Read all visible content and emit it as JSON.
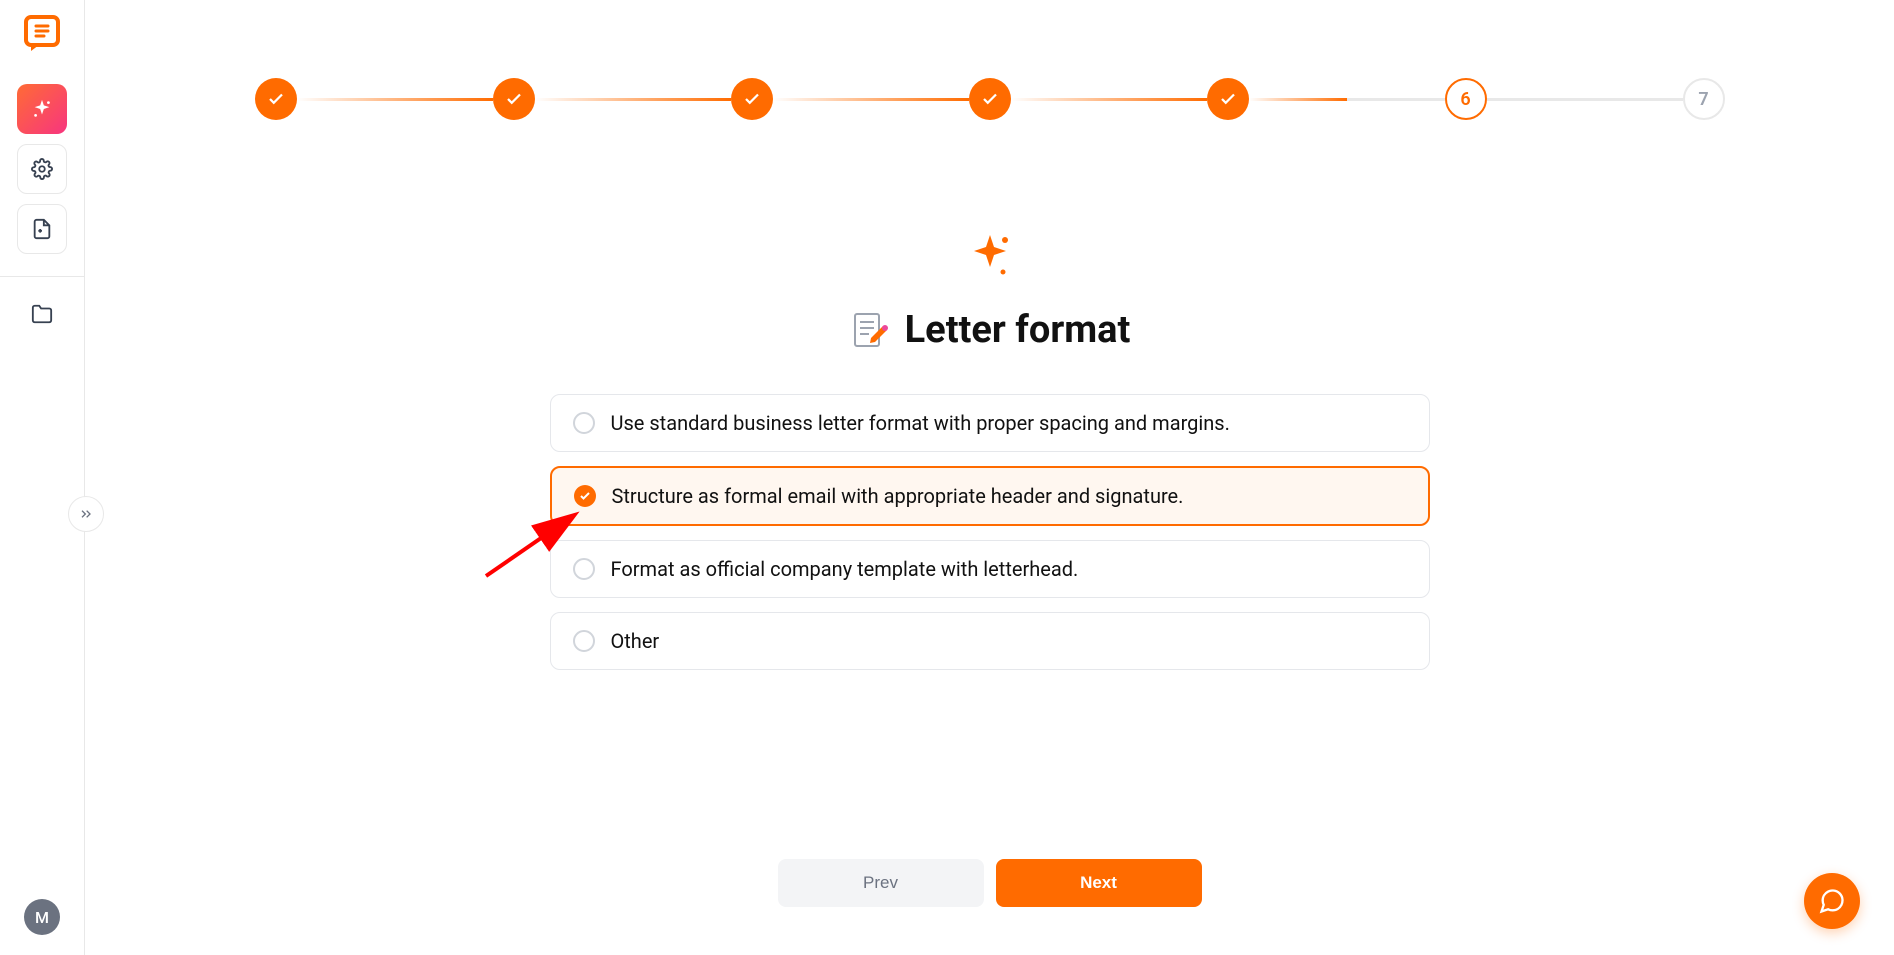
{
  "sidebar": {
    "avatar_initial": "M"
  },
  "stepper": {
    "current": "6",
    "upcoming": "7"
  },
  "page": {
    "title": "Letter format"
  },
  "options": [
    {
      "label": "Use standard business letter format with proper spacing and margins.",
      "selected": false
    },
    {
      "label": "Structure as formal email with appropriate header and signature.",
      "selected": true
    },
    {
      "label": "Format as official company template with letterhead.",
      "selected": false
    },
    {
      "label": "Other",
      "selected": false
    }
  ],
  "footer": {
    "prev": "Prev",
    "next": "Next"
  }
}
